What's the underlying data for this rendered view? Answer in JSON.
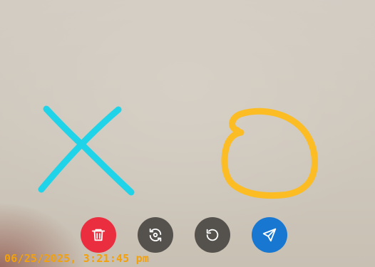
{
  "camera": {
    "timestamp": "06/25/2025, 3:21:45 pm"
  },
  "drawing": {
    "strokes": [
      {
        "shape": "x-mark",
        "color": "#1fd3e8"
      },
      {
        "shape": "circle",
        "color": "#fcbc24"
      }
    ]
  },
  "controls": {
    "delete": {
      "icon": "trash-icon",
      "color": "#ea2e3f"
    },
    "switch_camera": {
      "icon": "camera-switch-icon",
      "color": "#55524d"
    },
    "undo": {
      "icon": "undo-icon",
      "color": "#55524d"
    },
    "send": {
      "icon": "send-icon",
      "color": "#1877d1"
    }
  },
  "colors": {
    "timestamp": "#f2a10c",
    "icon_foreground": "#ffffff"
  }
}
